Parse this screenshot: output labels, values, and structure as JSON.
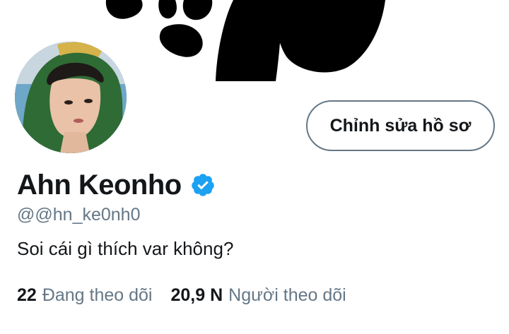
{
  "profile": {
    "display_name": "Ahn Keonho",
    "verified": true,
    "handle": "@@hn_ke0nh0",
    "bio": "Soi cái gì thích var không?"
  },
  "actions": {
    "edit_profile_label": "Chỉnh sửa hồ sơ"
  },
  "stats": {
    "following_count": "22",
    "following_label": "Đang theo dõi",
    "followers_count": "20,9 N",
    "followers_label": "Người theo dõi"
  },
  "colors": {
    "verified_badge": "#1da1f2",
    "secondary_text": "#657786",
    "primary_text": "#14171a",
    "button_border": "#657786"
  },
  "icons": {
    "verified": "verified-badge-icon"
  }
}
